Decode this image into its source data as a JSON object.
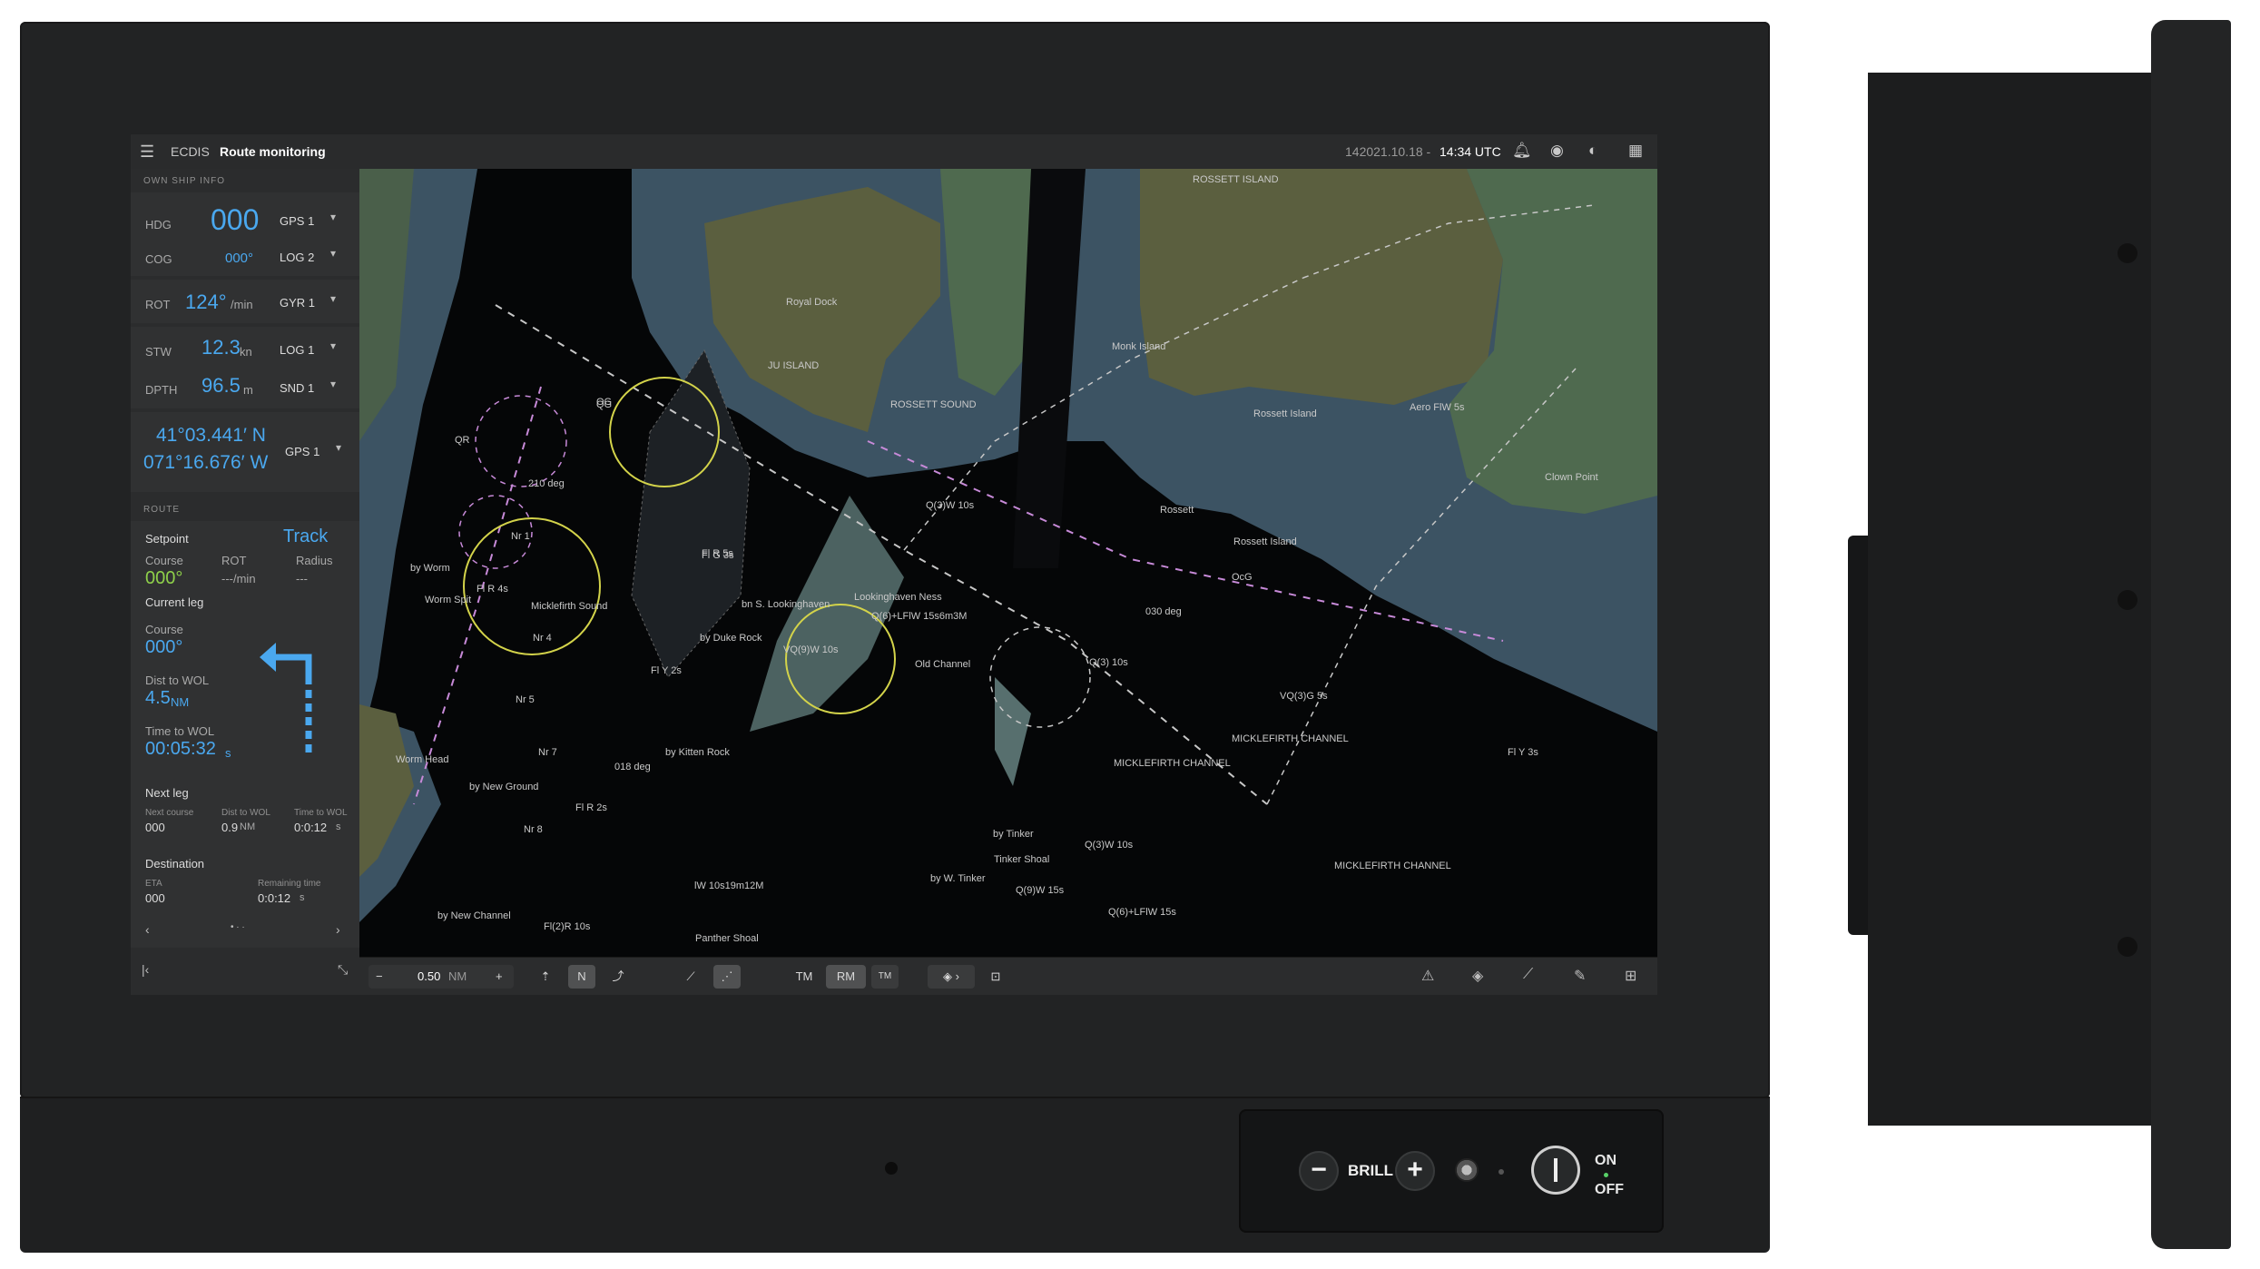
{
  "header": {
    "app": "ECDIS",
    "mode": "Route monitoring",
    "datetime_prefix": "142021.10.18 - ",
    "time": "14:34 UTC"
  },
  "own_ship": {
    "title": "OWN SHIP INFO",
    "hdg_label": "HDG",
    "hdg_value": "000",
    "hdg_source": "GPS 1",
    "cog_label": "COG",
    "cog_value": "000°",
    "cog_source": "LOG 2",
    "rot_label": "ROT",
    "rot_value": "124°",
    "rot_unit": "/min",
    "rot_source": "GYR 1",
    "stw_label": "STW",
    "stw_value": "12.3",
    "stw_unit": "kn",
    "stw_source": "LOG 1",
    "dpth_label": "DPTH",
    "dpth_value": "96.5",
    "dpth_unit": "m",
    "dpth_source": "SND 1",
    "lat": "41°03.441′ N",
    "lon": "071°16.676′ W",
    "pos_source": "GPS 1"
  },
  "route": {
    "title": "ROUTE",
    "setpoint_label": "Setpoint",
    "setpoint_mode": "Track",
    "course_label": "Course",
    "course_value": "000°",
    "rot_label": "ROT",
    "rot_value": "---/min",
    "radius_label": "Radius",
    "radius_value": "---",
    "current_leg_label": "Current leg",
    "cl_course_label": "Course",
    "cl_course_value": "000°",
    "dist_label": "Dist to WOL",
    "dist_value": "4.5",
    "dist_unit": "NM",
    "time_label": "Time to WOL",
    "time_value": "00:05:32",
    "time_unit": "s",
    "next_leg_label": "Next leg",
    "nl_course_label": "Next course",
    "nl_course_value": "000",
    "nl_dist_label": "Dist to WOL",
    "nl_dist_value": "0.9",
    "nl_dist_unit": "NM",
    "nl_time_label": "Time to WOL",
    "nl_time_value": "0:0:12",
    "nl_time_unit": "s",
    "dest_label": "Destination",
    "eta_label": "ETA",
    "eta_value": "000",
    "rem_label": "Remaining time",
    "rem_value": "0:0:12",
    "rem_unit": "s"
  },
  "toolbar": {
    "range_value": "0.50",
    "range_unit": "NM",
    "tm_label": "TM",
    "rm_label": "RM",
    "tm2_label": "TM"
  },
  "chart_labels": {
    "a1": "ROSSETT ISLAND",
    "a2": "Rossett Island",
    "a3": "Monk Island",
    "a4": "Rossett Island",
    "a5": "Aero FlW 5s",
    "a6": "Clown Point",
    "a7": "ROSSETT SOUND",
    "a8": "Royal Dock",
    "a9": "JU ISLAND",
    "a10": "Q(3)W 10s",
    "a11": "Lookinghaven Ness",
    "a12": "Q(6)+LFlW 15s6m3M",
    "a13": "bn S. Lookinghaven",
    "a14": "VQ(9)W 10s",
    "a15": "Old Channel",
    "a16": "Q(3) 10s",
    "a17": "VQ(3)G 5s",
    "a18": "MICKLEFIRTH CHANNEL",
    "a19": "MICKLEFIRTH CHANNEL",
    "a20": "Fl Y 3s",
    "a21": "Micklefirth Sound",
    "a22": "by Duke Rock",
    "a23": "by Worm",
    "a24": "Worm Spit",
    "a25": "by New Ground",
    "a26": "Fl R 2s",
    "a27": "by Kitten Rock",
    "a28": "Fl Y 2s",
    "a29": "by Tinker",
    "a30": "Tinker Shoal",
    "a31": "Q(3)W 10s",
    "a32": "Q(6)+LFlW 15s",
    "a33": "by W. Tinker",
    "a34": "Q(9)W 15s",
    "a35": "MICKLEFIRTH CHANNEL",
    "a36": "Panther Shoal",
    "a37": "Fl(2)R 10s",
    "a38": "by New Channel",
    "a39": "lW 10s19m12M",
    "a40": "Fl G 3s",
    "a41": "OG",
    "a42": "Fl R 4s",
    "a43": "Nr 1",
    "a44": "Nr 4",
    "a45": "Nr 5",
    "a46": "Nr 7",
    "a47": "Nr 8",
    "a48": "030 deg",
    "a49": "018 deg",
    "a50": "210 deg",
    "a51": "QR",
    "a52": "QG",
    "a53": "Fl R 5s",
    "a54": "Rossett",
    "a55": "OcG",
    "a56": "Worm Head"
  },
  "hardware": {
    "brill_label": "BRILL",
    "on_label": "ON",
    "off_label": "OFF"
  },
  "colors": {
    "accent": "#4aa8ef",
    "setpoint_green": "#8ed04a",
    "land": "#5b5f3f",
    "shallow": "#3c5363",
    "intertidal": "#3f5f4f"
  }
}
